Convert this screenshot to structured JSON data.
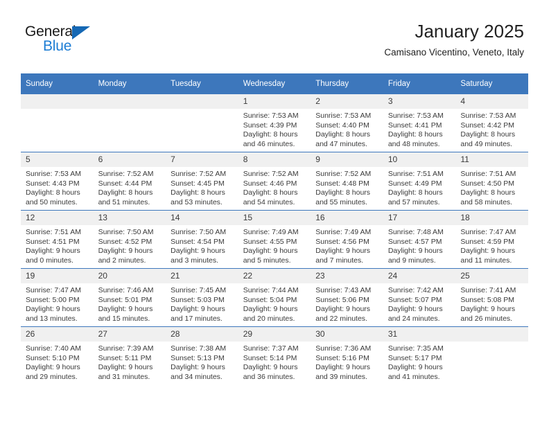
{
  "logo": {
    "word_top": "General",
    "word_bottom": "Blue",
    "triangle_color": "#1568b4",
    "blue_text_color": "#1d7dd4"
  },
  "header": {
    "title": "January 2025",
    "subtitle": "Camisano Vicentino, Veneto, Italy"
  },
  "theme": {
    "header_blue": "#3d77bc",
    "daynum_band": "#f0f0f0",
    "text_color": "#3a3a3a"
  },
  "weekday_headers": [
    "Sunday",
    "Monday",
    "Tuesday",
    "Wednesday",
    "Thursday",
    "Friday",
    "Saturday"
  ],
  "labels": {
    "sunrise_prefix": "Sunrise: ",
    "sunset_prefix": "Sunset: ",
    "daylight_prefix": "Daylight: "
  },
  "weeks": [
    [
      {
        "day": "",
        "empty": true
      },
      {
        "day": "",
        "empty": true
      },
      {
        "day": "",
        "empty": true
      },
      {
        "day": "1",
        "sunrise": "Sunrise: 7:53 AM",
        "sunset": "Sunset: 4:39 PM",
        "daylight_1": "Daylight: 8 hours",
        "daylight_2": "and 46 minutes."
      },
      {
        "day": "2",
        "sunrise": "Sunrise: 7:53 AM",
        "sunset": "Sunset: 4:40 PM",
        "daylight_1": "Daylight: 8 hours",
        "daylight_2": "and 47 minutes."
      },
      {
        "day": "3",
        "sunrise": "Sunrise: 7:53 AM",
        "sunset": "Sunset: 4:41 PM",
        "daylight_1": "Daylight: 8 hours",
        "daylight_2": "and 48 minutes."
      },
      {
        "day": "4",
        "sunrise": "Sunrise: 7:53 AM",
        "sunset": "Sunset: 4:42 PM",
        "daylight_1": "Daylight: 8 hours",
        "daylight_2": "and 49 minutes."
      }
    ],
    [
      {
        "day": "5",
        "sunrise": "Sunrise: 7:53 AM",
        "sunset": "Sunset: 4:43 PM",
        "daylight_1": "Daylight: 8 hours",
        "daylight_2": "and 50 minutes."
      },
      {
        "day": "6",
        "sunrise": "Sunrise: 7:52 AM",
        "sunset": "Sunset: 4:44 PM",
        "daylight_1": "Daylight: 8 hours",
        "daylight_2": "and 51 minutes."
      },
      {
        "day": "7",
        "sunrise": "Sunrise: 7:52 AM",
        "sunset": "Sunset: 4:45 PM",
        "daylight_1": "Daylight: 8 hours",
        "daylight_2": "and 53 minutes."
      },
      {
        "day": "8",
        "sunrise": "Sunrise: 7:52 AM",
        "sunset": "Sunset: 4:46 PM",
        "daylight_1": "Daylight: 8 hours",
        "daylight_2": "and 54 minutes."
      },
      {
        "day": "9",
        "sunrise": "Sunrise: 7:52 AM",
        "sunset": "Sunset: 4:48 PM",
        "daylight_1": "Daylight: 8 hours",
        "daylight_2": "and 55 minutes."
      },
      {
        "day": "10",
        "sunrise": "Sunrise: 7:51 AM",
        "sunset": "Sunset: 4:49 PM",
        "daylight_1": "Daylight: 8 hours",
        "daylight_2": "and 57 minutes."
      },
      {
        "day": "11",
        "sunrise": "Sunrise: 7:51 AM",
        "sunset": "Sunset: 4:50 PM",
        "daylight_1": "Daylight: 8 hours",
        "daylight_2": "and 58 minutes."
      }
    ],
    [
      {
        "day": "12",
        "sunrise": "Sunrise: 7:51 AM",
        "sunset": "Sunset: 4:51 PM",
        "daylight_1": "Daylight: 9 hours",
        "daylight_2": "and 0 minutes."
      },
      {
        "day": "13",
        "sunrise": "Sunrise: 7:50 AM",
        "sunset": "Sunset: 4:52 PM",
        "daylight_1": "Daylight: 9 hours",
        "daylight_2": "and 2 minutes."
      },
      {
        "day": "14",
        "sunrise": "Sunrise: 7:50 AM",
        "sunset": "Sunset: 4:54 PM",
        "daylight_1": "Daylight: 9 hours",
        "daylight_2": "and 3 minutes."
      },
      {
        "day": "15",
        "sunrise": "Sunrise: 7:49 AM",
        "sunset": "Sunset: 4:55 PM",
        "daylight_1": "Daylight: 9 hours",
        "daylight_2": "and 5 minutes."
      },
      {
        "day": "16",
        "sunrise": "Sunrise: 7:49 AM",
        "sunset": "Sunset: 4:56 PM",
        "daylight_1": "Daylight: 9 hours",
        "daylight_2": "and 7 minutes."
      },
      {
        "day": "17",
        "sunrise": "Sunrise: 7:48 AM",
        "sunset": "Sunset: 4:57 PM",
        "daylight_1": "Daylight: 9 hours",
        "daylight_2": "and 9 minutes."
      },
      {
        "day": "18",
        "sunrise": "Sunrise: 7:47 AM",
        "sunset": "Sunset: 4:59 PM",
        "daylight_1": "Daylight: 9 hours",
        "daylight_2": "and 11 minutes."
      }
    ],
    [
      {
        "day": "19",
        "sunrise": "Sunrise: 7:47 AM",
        "sunset": "Sunset: 5:00 PM",
        "daylight_1": "Daylight: 9 hours",
        "daylight_2": "and 13 minutes."
      },
      {
        "day": "20",
        "sunrise": "Sunrise: 7:46 AM",
        "sunset": "Sunset: 5:01 PM",
        "daylight_1": "Daylight: 9 hours",
        "daylight_2": "and 15 minutes."
      },
      {
        "day": "21",
        "sunrise": "Sunrise: 7:45 AM",
        "sunset": "Sunset: 5:03 PM",
        "daylight_1": "Daylight: 9 hours",
        "daylight_2": "and 17 minutes."
      },
      {
        "day": "22",
        "sunrise": "Sunrise: 7:44 AM",
        "sunset": "Sunset: 5:04 PM",
        "daylight_1": "Daylight: 9 hours",
        "daylight_2": "and 20 minutes."
      },
      {
        "day": "23",
        "sunrise": "Sunrise: 7:43 AM",
        "sunset": "Sunset: 5:06 PM",
        "daylight_1": "Daylight: 9 hours",
        "daylight_2": "and 22 minutes."
      },
      {
        "day": "24",
        "sunrise": "Sunrise: 7:42 AM",
        "sunset": "Sunset: 5:07 PM",
        "daylight_1": "Daylight: 9 hours",
        "daylight_2": "and 24 minutes."
      },
      {
        "day": "25",
        "sunrise": "Sunrise: 7:41 AM",
        "sunset": "Sunset: 5:08 PM",
        "daylight_1": "Daylight: 9 hours",
        "daylight_2": "and 26 minutes."
      }
    ],
    [
      {
        "day": "26",
        "sunrise": "Sunrise: 7:40 AM",
        "sunset": "Sunset: 5:10 PM",
        "daylight_1": "Daylight: 9 hours",
        "daylight_2": "and 29 minutes."
      },
      {
        "day": "27",
        "sunrise": "Sunrise: 7:39 AM",
        "sunset": "Sunset: 5:11 PM",
        "daylight_1": "Daylight: 9 hours",
        "daylight_2": "and 31 minutes."
      },
      {
        "day": "28",
        "sunrise": "Sunrise: 7:38 AM",
        "sunset": "Sunset: 5:13 PM",
        "daylight_1": "Daylight: 9 hours",
        "daylight_2": "and 34 minutes."
      },
      {
        "day": "29",
        "sunrise": "Sunrise: 7:37 AM",
        "sunset": "Sunset: 5:14 PM",
        "daylight_1": "Daylight: 9 hours",
        "daylight_2": "and 36 minutes."
      },
      {
        "day": "30",
        "sunrise": "Sunrise: 7:36 AM",
        "sunset": "Sunset: 5:16 PM",
        "daylight_1": "Daylight: 9 hours",
        "daylight_2": "and 39 minutes."
      },
      {
        "day": "31",
        "sunrise": "Sunrise: 7:35 AM",
        "sunset": "Sunset: 5:17 PM",
        "daylight_1": "Daylight: 9 hours",
        "daylight_2": "and 41 minutes."
      },
      {
        "day": "",
        "empty": true
      }
    ]
  ]
}
